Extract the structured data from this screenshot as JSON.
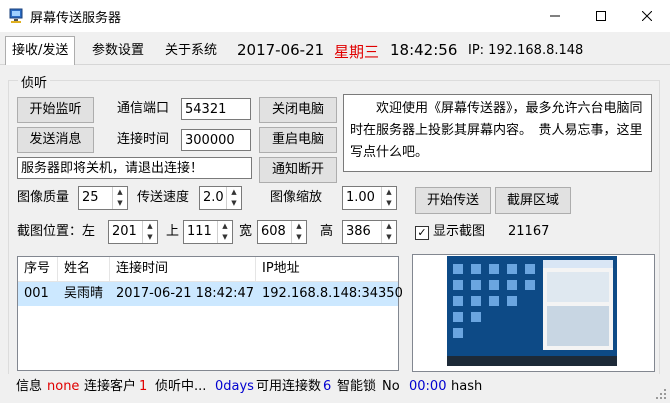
{
  "window": {
    "title": "屏幕传送服务器",
    "minimize_icon": "minimize-icon",
    "maximize_icon": "maximize-icon",
    "close_icon": "close-icon"
  },
  "tabs": [
    {
      "label": "接收/发送"
    },
    {
      "label": "参数设置"
    },
    {
      "label": "关于系统"
    }
  ],
  "header": {
    "date": "2017-06-21",
    "weekday": "星期三",
    "time": "18:42:56",
    "ip": "IP: 192.168.8.148",
    "weekday_color": "#e00000"
  },
  "listen_group": {
    "label": "侦听"
  },
  "buttons": {
    "start_listen": "开始监听",
    "send_message": "发送消息",
    "shutdown": "关闭电脑",
    "restart": "重启电脑",
    "notify_disconnect": "通知断开",
    "start_transfer": "开始传送",
    "capture_area": "截屏区域"
  },
  "fields": {
    "port_label": "通信端口",
    "port_value": "54321",
    "conn_time_label": "连接时间",
    "conn_time_value": "300000",
    "message_value": "服务器即将关机，请退出连接！",
    "quality_label": "图像质量",
    "quality_value": "25",
    "speed_label": "传送速度",
    "speed_value": "2.0",
    "scale_label": "图像缩放",
    "scale_value": "1.00",
    "pos_label": "截图位置：左",
    "left_value": "201",
    "top_label": "上",
    "top_value": "111",
    "width_label": "宽",
    "width_value": "608",
    "height_label": "高",
    "height_value": "386",
    "show_capture_label": "显示截图",
    "show_capture_checked": true,
    "capture_count": "21167"
  },
  "memo": {
    "text": "　　欢迎使用《屏幕传送器》，最多允许六台电脑同时在服务器上投影其屏幕内容。　贵人易忘事，这里写点什么吧。"
  },
  "table": {
    "columns": [
      "序号",
      "姓名",
      "连接时间",
      "IP地址"
    ],
    "rows": [
      [
        "001",
        "吴雨晴",
        "2017-06-21 18:42:47",
        "192.168.8.148:34350"
      ]
    ]
  },
  "status": {
    "info_label": "信息",
    "info_value": "none",
    "clients_label": "连接客户",
    "clients_value": "1",
    "listening": "侦听中...",
    "days": "0days",
    "available_label": "可用连接数",
    "available_value": "6",
    "lock_label": "智能锁",
    "lock_value": "No",
    "lock_time": "00:00",
    "hash_label": "hash",
    "accent_red": "#e00000",
    "accent_blue": "#0000d0"
  }
}
